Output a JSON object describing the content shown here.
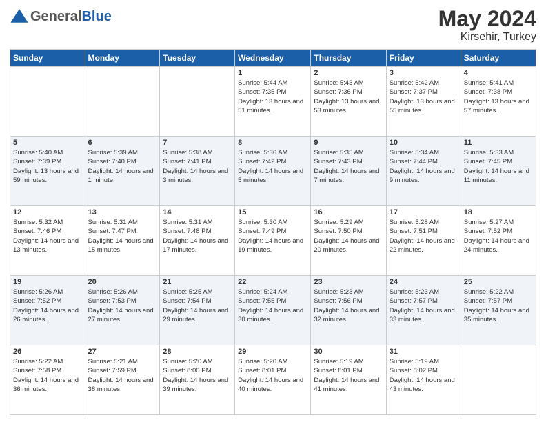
{
  "header": {
    "logo_general": "General",
    "logo_blue": "Blue",
    "month": "May 2024",
    "location": "Kirsehir, Turkey"
  },
  "days_of_week": [
    "Sunday",
    "Monday",
    "Tuesday",
    "Wednesday",
    "Thursday",
    "Friday",
    "Saturday"
  ],
  "weeks": [
    [
      {
        "day": "",
        "sunrise": "",
        "sunset": "",
        "daylight": ""
      },
      {
        "day": "",
        "sunrise": "",
        "sunset": "",
        "daylight": ""
      },
      {
        "day": "",
        "sunrise": "",
        "sunset": "",
        "daylight": ""
      },
      {
        "day": "1",
        "sunrise": "Sunrise: 5:44 AM",
        "sunset": "Sunset: 7:35 PM",
        "daylight": "Daylight: 13 hours and 51 minutes."
      },
      {
        "day": "2",
        "sunrise": "Sunrise: 5:43 AM",
        "sunset": "Sunset: 7:36 PM",
        "daylight": "Daylight: 13 hours and 53 minutes."
      },
      {
        "day": "3",
        "sunrise": "Sunrise: 5:42 AM",
        "sunset": "Sunset: 7:37 PM",
        "daylight": "Daylight: 13 hours and 55 minutes."
      },
      {
        "day": "4",
        "sunrise": "Sunrise: 5:41 AM",
        "sunset": "Sunset: 7:38 PM",
        "daylight": "Daylight: 13 hours and 57 minutes."
      }
    ],
    [
      {
        "day": "5",
        "sunrise": "Sunrise: 5:40 AM",
        "sunset": "Sunset: 7:39 PM",
        "daylight": "Daylight: 13 hours and 59 minutes."
      },
      {
        "day": "6",
        "sunrise": "Sunrise: 5:39 AM",
        "sunset": "Sunset: 7:40 PM",
        "daylight": "Daylight: 14 hours and 1 minute."
      },
      {
        "day": "7",
        "sunrise": "Sunrise: 5:38 AM",
        "sunset": "Sunset: 7:41 PM",
        "daylight": "Daylight: 14 hours and 3 minutes."
      },
      {
        "day": "8",
        "sunrise": "Sunrise: 5:36 AM",
        "sunset": "Sunset: 7:42 PM",
        "daylight": "Daylight: 14 hours and 5 minutes."
      },
      {
        "day": "9",
        "sunrise": "Sunrise: 5:35 AM",
        "sunset": "Sunset: 7:43 PM",
        "daylight": "Daylight: 14 hours and 7 minutes."
      },
      {
        "day": "10",
        "sunrise": "Sunrise: 5:34 AM",
        "sunset": "Sunset: 7:44 PM",
        "daylight": "Daylight: 14 hours and 9 minutes."
      },
      {
        "day": "11",
        "sunrise": "Sunrise: 5:33 AM",
        "sunset": "Sunset: 7:45 PM",
        "daylight": "Daylight: 14 hours and 11 minutes."
      }
    ],
    [
      {
        "day": "12",
        "sunrise": "Sunrise: 5:32 AM",
        "sunset": "Sunset: 7:46 PM",
        "daylight": "Daylight: 14 hours and 13 minutes."
      },
      {
        "day": "13",
        "sunrise": "Sunrise: 5:31 AM",
        "sunset": "Sunset: 7:47 PM",
        "daylight": "Daylight: 14 hours and 15 minutes."
      },
      {
        "day": "14",
        "sunrise": "Sunrise: 5:31 AM",
        "sunset": "Sunset: 7:48 PM",
        "daylight": "Daylight: 14 hours and 17 minutes."
      },
      {
        "day": "15",
        "sunrise": "Sunrise: 5:30 AM",
        "sunset": "Sunset: 7:49 PM",
        "daylight": "Daylight: 14 hours and 19 minutes."
      },
      {
        "day": "16",
        "sunrise": "Sunrise: 5:29 AM",
        "sunset": "Sunset: 7:50 PM",
        "daylight": "Daylight: 14 hours and 20 minutes."
      },
      {
        "day": "17",
        "sunrise": "Sunrise: 5:28 AM",
        "sunset": "Sunset: 7:51 PM",
        "daylight": "Daylight: 14 hours and 22 minutes."
      },
      {
        "day": "18",
        "sunrise": "Sunrise: 5:27 AM",
        "sunset": "Sunset: 7:52 PM",
        "daylight": "Daylight: 14 hours and 24 minutes."
      }
    ],
    [
      {
        "day": "19",
        "sunrise": "Sunrise: 5:26 AM",
        "sunset": "Sunset: 7:52 PM",
        "daylight": "Daylight: 14 hours and 26 minutes."
      },
      {
        "day": "20",
        "sunrise": "Sunrise: 5:26 AM",
        "sunset": "Sunset: 7:53 PM",
        "daylight": "Daylight: 14 hours and 27 minutes."
      },
      {
        "day": "21",
        "sunrise": "Sunrise: 5:25 AM",
        "sunset": "Sunset: 7:54 PM",
        "daylight": "Daylight: 14 hours and 29 minutes."
      },
      {
        "day": "22",
        "sunrise": "Sunrise: 5:24 AM",
        "sunset": "Sunset: 7:55 PM",
        "daylight": "Daylight: 14 hours and 30 minutes."
      },
      {
        "day": "23",
        "sunrise": "Sunrise: 5:23 AM",
        "sunset": "Sunset: 7:56 PM",
        "daylight": "Daylight: 14 hours and 32 minutes."
      },
      {
        "day": "24",
        "sunrise": "Sunrise: 5:23 AM",
        "sunset": "Sunset: 7:57 PM",
        "daylight": "Daylight: 14 hours and 33 minutes."
      },
      {
        "day": "25",
        "sunrise": "Sunrise: 5:22 AM",
        "sunset": "Sunset: 7:57 PM",
        "daylight": "Daylight: 14 hours and 35 minutes."
      }
    ],
    [
      {
        "day": "26",
        "sunrise": "Sunrise: 5:22 AM",
        "sunset": "Sunset: 7:58 PM",
        "daylight": "Daylight: 14 hours and 36 minutes."
      },
      {
        "day": "27",
        "sunrise": "Sunrise: 5:21 AM",
        "sunset": "Sunset: 7:59 PM",
        "daylight": "Daylight: 14 hours and 38 minutes."
      },
      {
        "day": "28",
        "sunrise": "Sunrise: 5:20 AM",
        "sunset": "Sunset: 8:00 PM",
        "daylight": "Daylight: 14 hours and 39 minutes."
      },
      {
        "day": "29",
        "sunrise": "Sunrise: 5:20 AM",
        "sunset": "Sunset: 8:01 PM",
        "daylight": "Daylight: 14 hours and 40 minutes."
      },
      {
        "day": "30",
        "sunrise": "Sunrise: 5:19 AM",
        "sunset": "Sunset: 8:01 PM",
        "daylight": "Daylight: 14 hours and 41 minutes."
      },
      {
        "day": "31",
        "sunrise": "Sunrise: 5:19 AM",
        "sunset": "Sunset: 8:02 PM",
        "daylight": "Daylight: 14 hours and 43 minutes."
      },
      {
        "day": "",
        "sunrise": "",
        "sunset": "",
        "daylight": ""
      }
    ]
  ]
}
